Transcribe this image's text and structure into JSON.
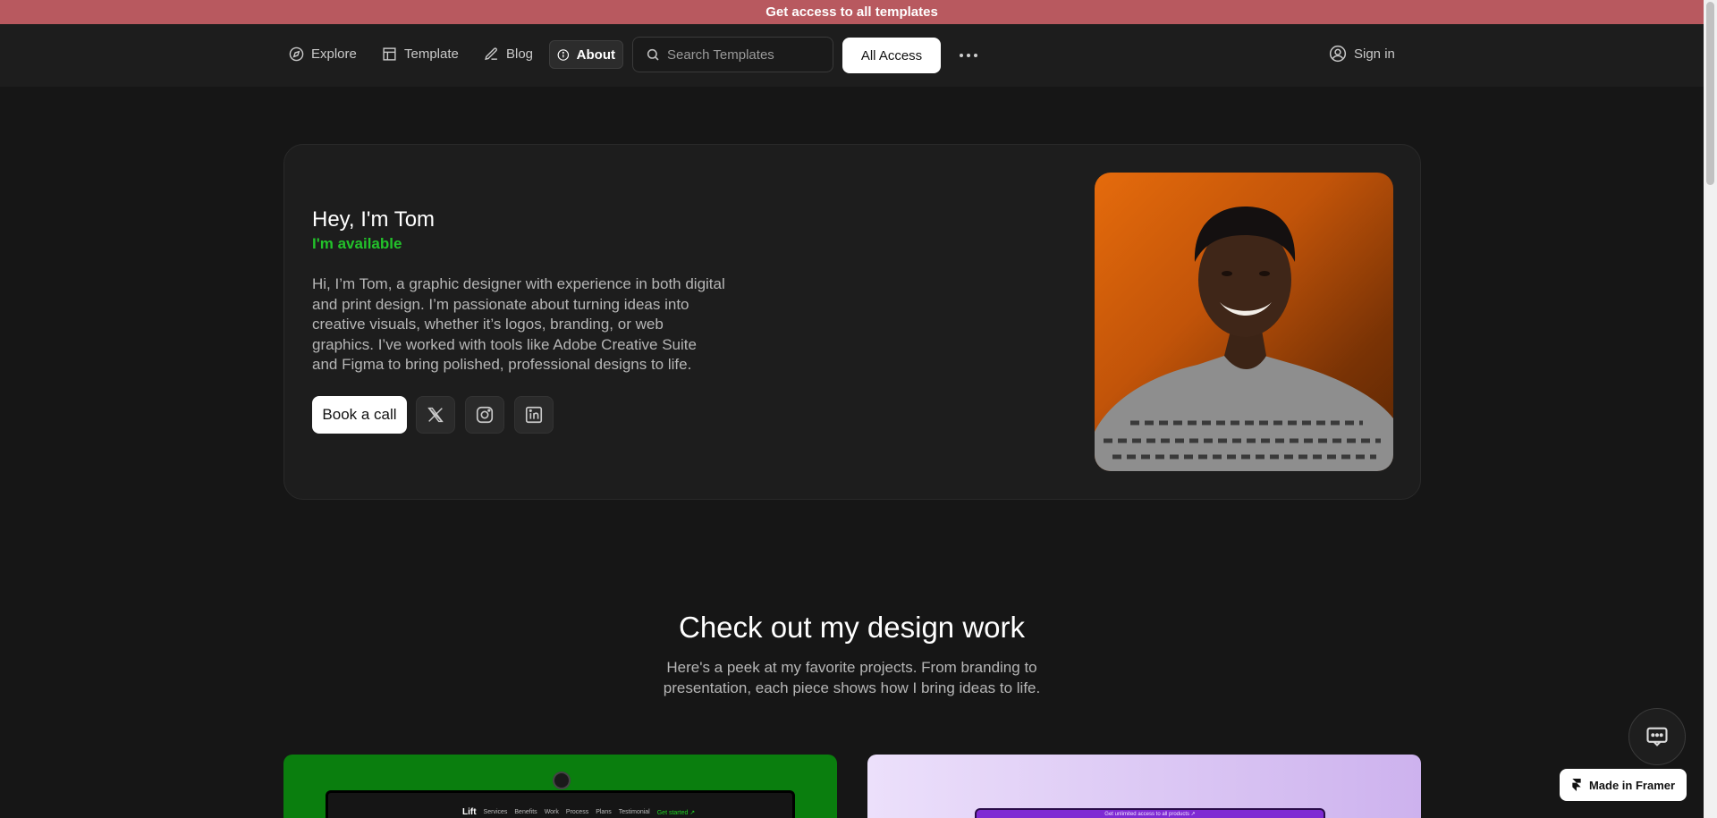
{
  "banner": {
    "text": "Get access to all templates"
  },
  "nav": {
    "items": [
      {
        "label": "Explore",
        "icon": "compass-icon"
      },
      {
        "label": "Template",
        "icon": "grid-icon"
      },
      {
        "label": "Blog",
        "icon": "pen-icon"
      },
      {
        "label": "About",
        "icon": "info-icon",
        "active": true
      }
    ],
    "search_placeholder": "Search Templates",
    "all_access_label": "All Access",
    "more_icon": "more-horizontal-icon",
    "signin_label": "Sign in"
  },
  "profile": {
    "heading": "Hey, I'm Tom",
    "status": "I'm available",
    "status_color": "#22c22a",
    "bio": "Hi, I’m Tom, a graphic designer with experience in both digital and print design. I’m passionate about turning ideas into creative visuals, whether it’s logos, branding, or web graphics. I’ve worked with tools like Adobe Creative Suite and Figma to bring polished, professional designs to life.",
    "book_label": "Book a call",
    "socials": [
      "x-icon",
      "instagram-icon",
      "linkedin-icon"
    ]
  },
  "work": {
    "title": "Check out my design work",
    "subtitle_line1": "Here's a peek at my favorite projects. From branding to",
    "subtitle_line2": "presentation, each piece shows how I bring ideas to life.",
    "preview1": {
      "brand": "Lift",
      "links": [
        "Services",
        "Benefits",
        "Work",
        "Process",
        "Plans",
        "Testimonial"
      ],
      "cta": "Get started ↗"
    },
    "preview2": {
      "bar_text": "Get unlimited access to all products ↗"
    }
  },
  "framer_badge": {
    "label": "Made in Framer"
  },
  "colors": {
    "banner": "#b8595f",
    "background": "#161616",
    "accent_green": "#22c22a"
  }
}
